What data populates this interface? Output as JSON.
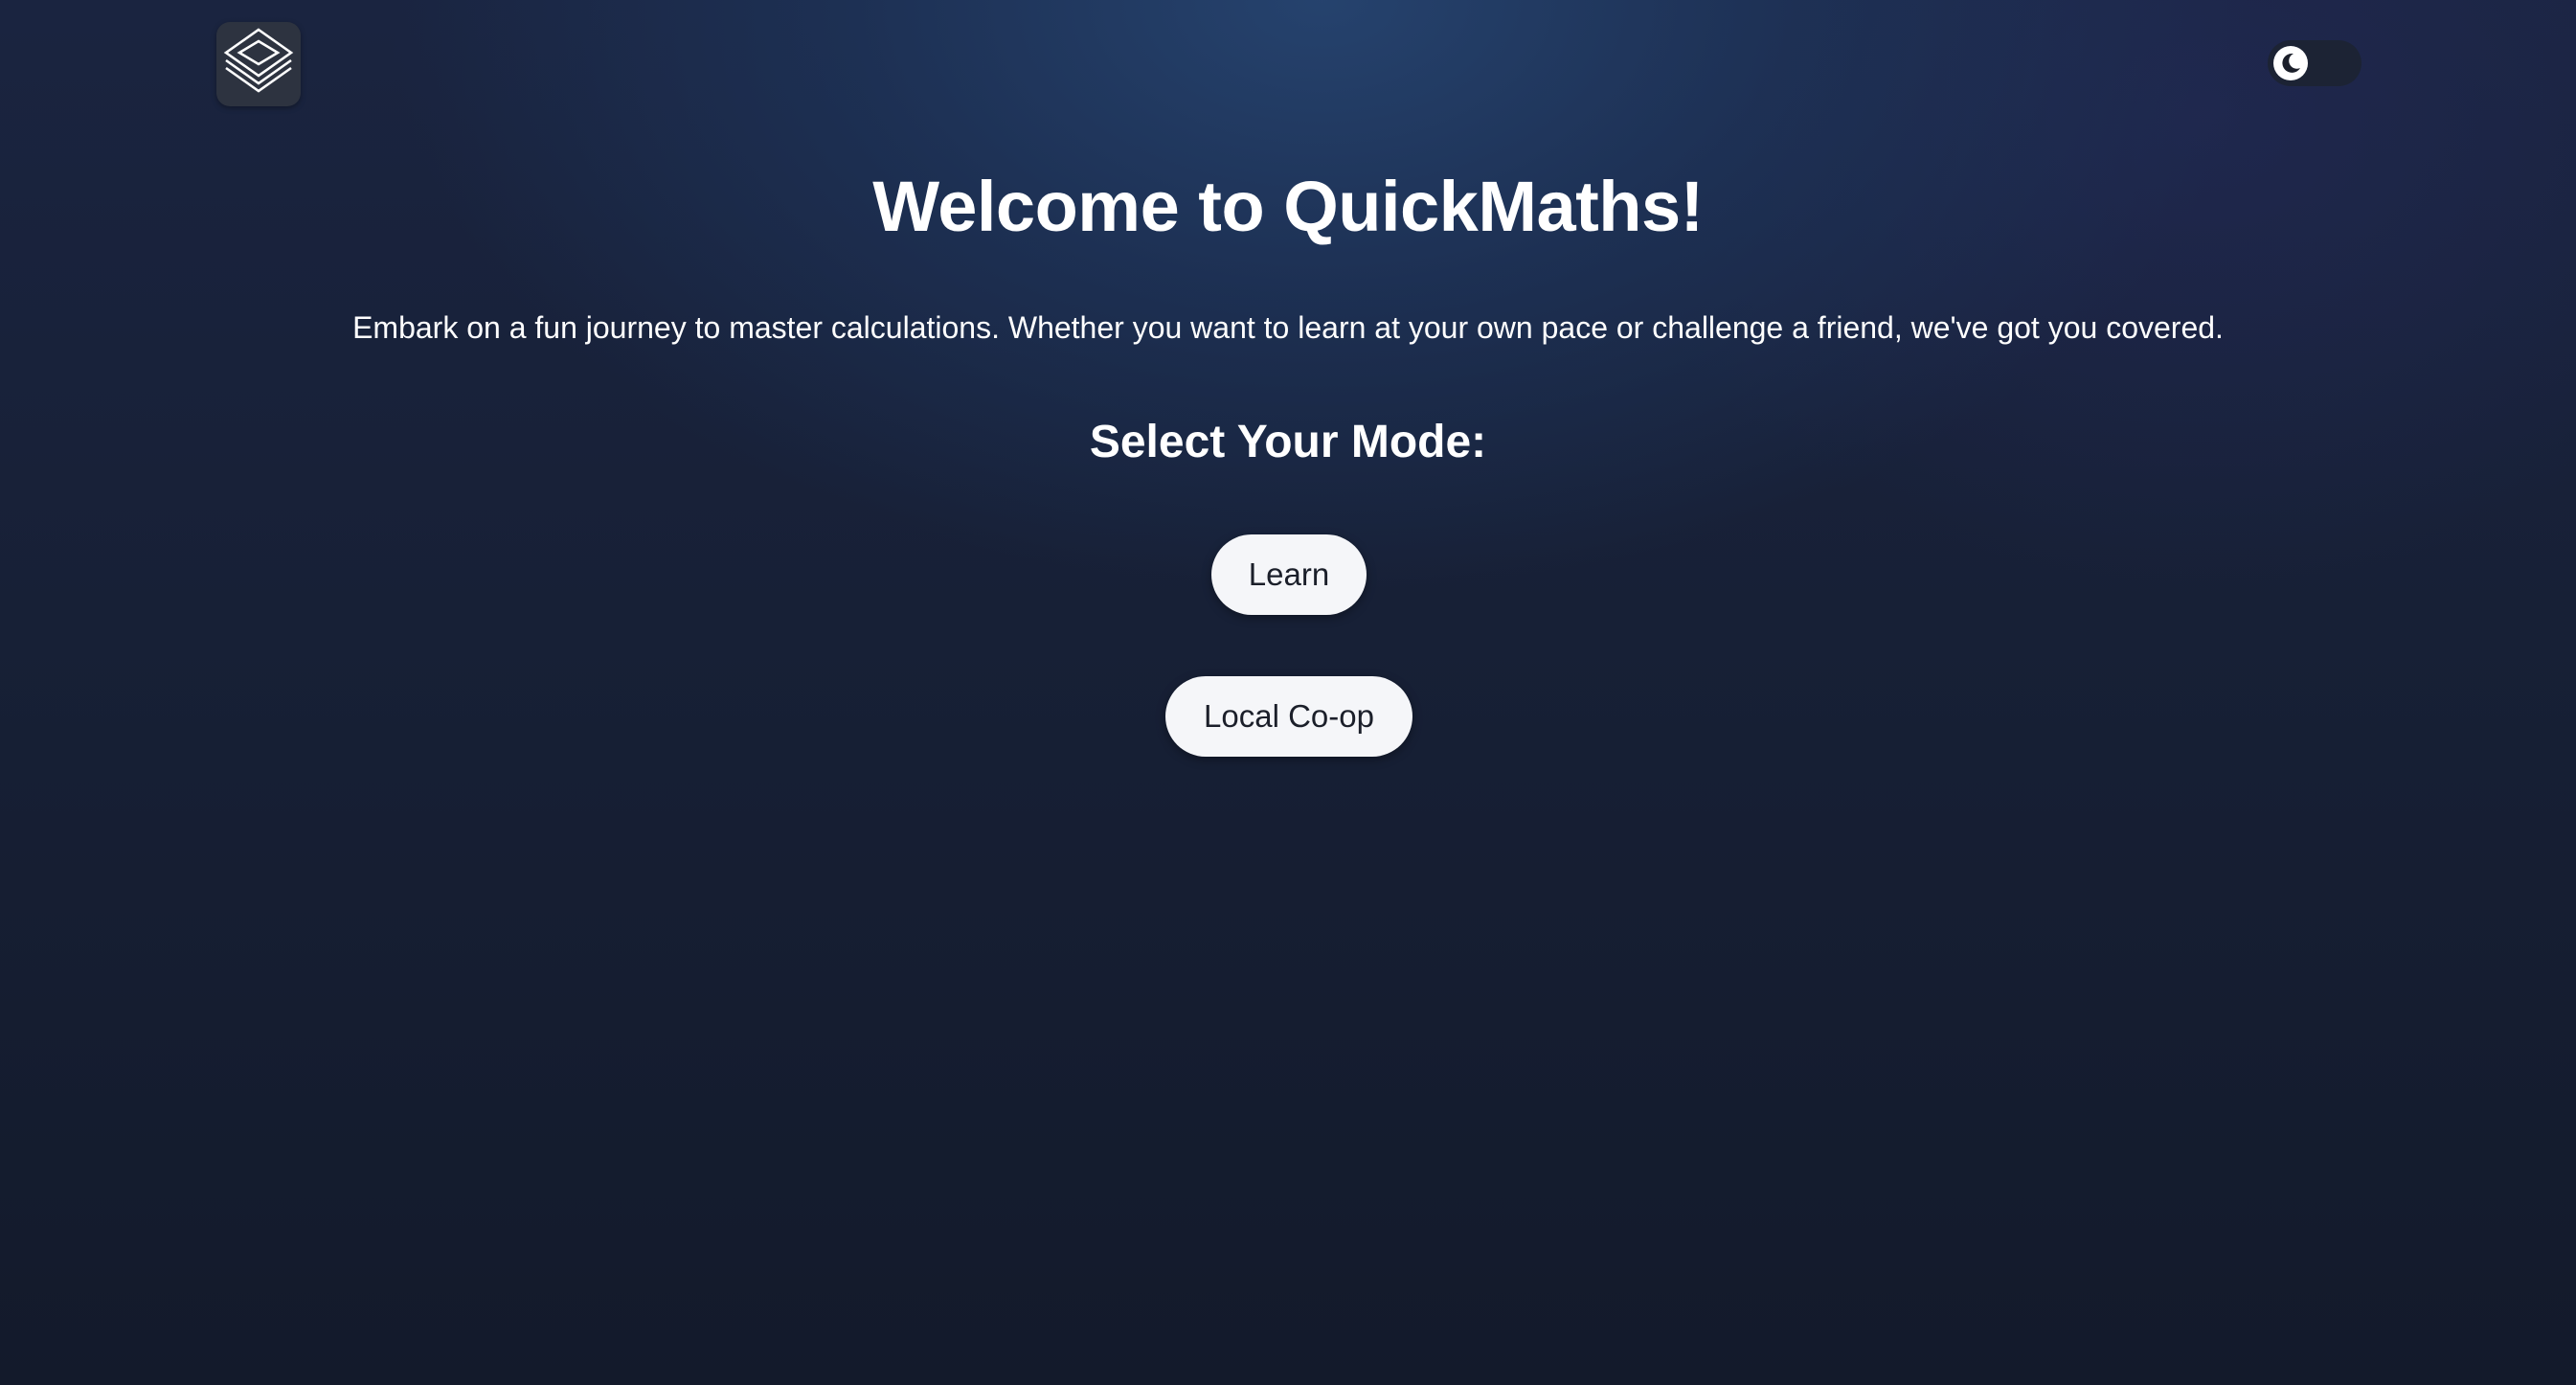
{
  "header": {
    "logo_icon": "layers-icon",
    "theme_toggle_icon": "moon-icon"
  },
  "main": {
    "title": "Welcome to QuickMaths!",
    "intro": "Embark on a fun journey to master calculations. Whether you want to learn at your own pace or challenge a friend, we've got you covered.",
    "mode_heading": "Select Your Mode:",
    "modes": [
      {
        "label": "Learn"
      },
      {
        "label": "Local Co-op"
      }
    ]
  },
  "colors": {
    "background_top": "#1e3458",
    "background_bottom": "#131a2b",
    "button_bg": "#f5f6f9",
    "button_text": "#1b1f2a",
    "text": "#ffffff"
  }
}
